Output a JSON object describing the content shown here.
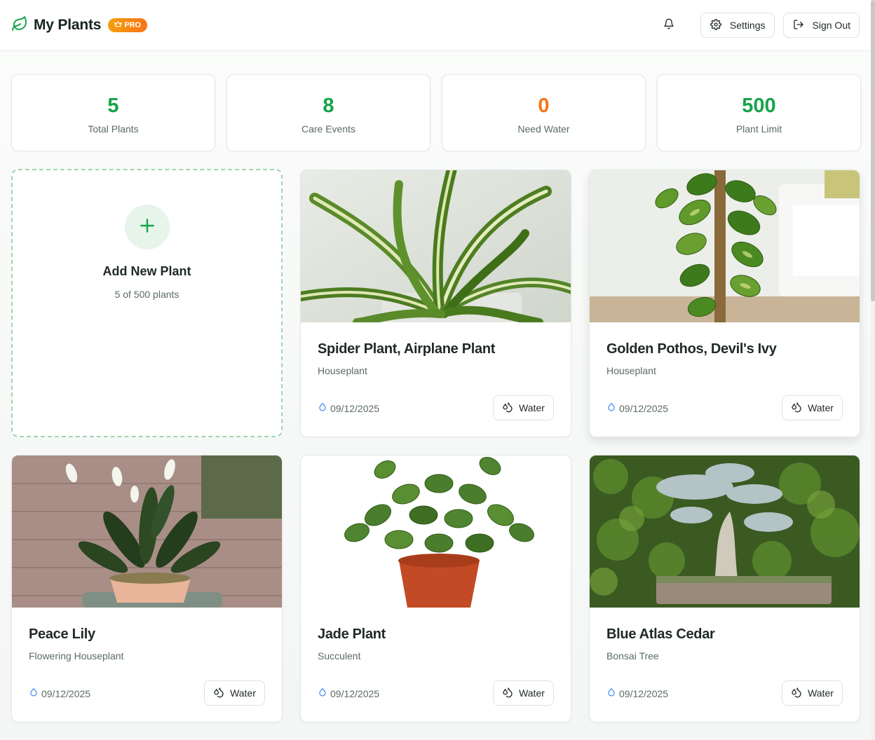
{
  "header": {
    "title": "My Plants",
    "pro_label": "PRO",
    "settings_label": "Settings",
    "signout_label": "Sign Out"
  },
  "stats": [
    {
      "value": "5",
      "label": "Total Plants",
      "color": "#16a34a"
    },
    {
      "value": "8",
      "label": "Care Events",
      "color": "#16a34a"
    },
    {
      "value": "0",
      "label": "Need Water",
      "color": "#f97316"
    },
    {
      "value": "500",
      "label": "Plant Limit",
      "color": "#16a34a"
    }
  ],
  "add_card": {
    "title": "Add New Plant",
    "subtitle": "5 of 500 plants"
  },
  "plants": [
    {
      "name": "Spider Plant, Airplane Plant",
      "type": "Houseplant",
      "date": "09/12/2025",
      "button": "Water",
      "image": "spider-plant-photo"
    },
    {
      "name": "Golden Pothos, Devil's Ivy",
      "type": "Houseplant",
      "date": "09/12/2025",
      "button": "Water",
      "image": "golden-pothos-photo"
    },
    {
      "name": "Peace Lily",
      "type": "Flowering Houseplant",
      "date": "09/12/2025",
      "button": "Water",
      "image": "peace-lily-photo"
    },
    {
      "name": "Jade Plant",
      "type": "Succulent",
      "date": "09/12/2025",
      "button": "Water",
      "image": "jade-plant-photo"
    },
    {
      "name": "Blue Atlas Cedar",
      "type": "Bonsai Tree",
      "date": "09/12/2025",
      "button": "Water",
      "image": "blue-atlas-cedar-photo"
    }
  ],
  "colors": {
    "accent": "#16a34a",
    "warning": "#f97316",
    "pro_badge": "#f59e0b"
  }
}
